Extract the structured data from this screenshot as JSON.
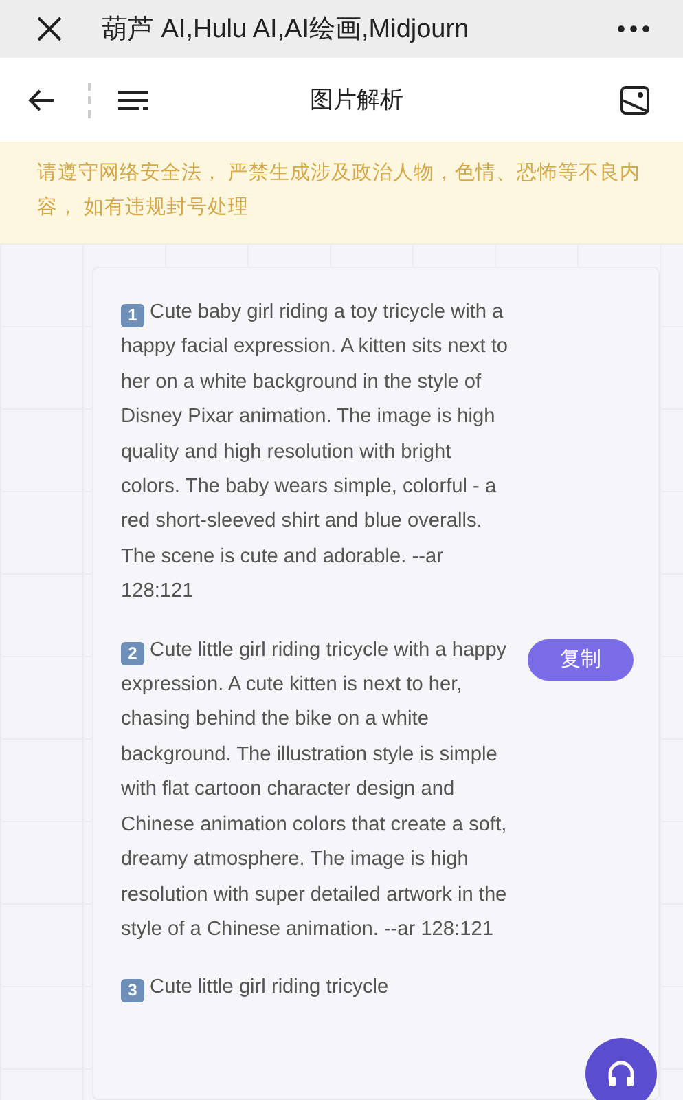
{
  "window": {
    "title": "葫芦 AI,Hulu AI,AI绘画,Midjourn"
  },
  "navbar": {
    "title": "图片解析"
  },
  "notice": "请遵守网络安全法， 严禁生成涉及政治人物，色情、恐怖等不良内容， 如有违规封号处理",
  "prompts": [
    {
      "number": "1",
      "text": "Cute baby girl riding a toy tricycle with a happy facial expression. A kitten sits next to her on a white background in the style of Disney Pixar animation. The image is high quality and high resolution with bright colors. The baby wears simple, colorful - a red short-sleeved shirt and blue overalls. The scene is cute and adorable. --ar 128:121"
    },
    {
      "number": "2",
      "text": "Cute little girl riding tricycle with a happy expression. A cute kitten is next to her, chasing behind the bike on a white background. The illustration style is simple with flat cartoon character design and Chinese animation colors that create a soft, dreamy atmosphere. The image is high resolution with super detailed artwork in the style of a Chinese animation. --ar 128:121",
      "copy_button": "复制"
    },
    {
      "number": "3",
      "text": "Cute little girl riding tricycle"
    }
  ]
}
